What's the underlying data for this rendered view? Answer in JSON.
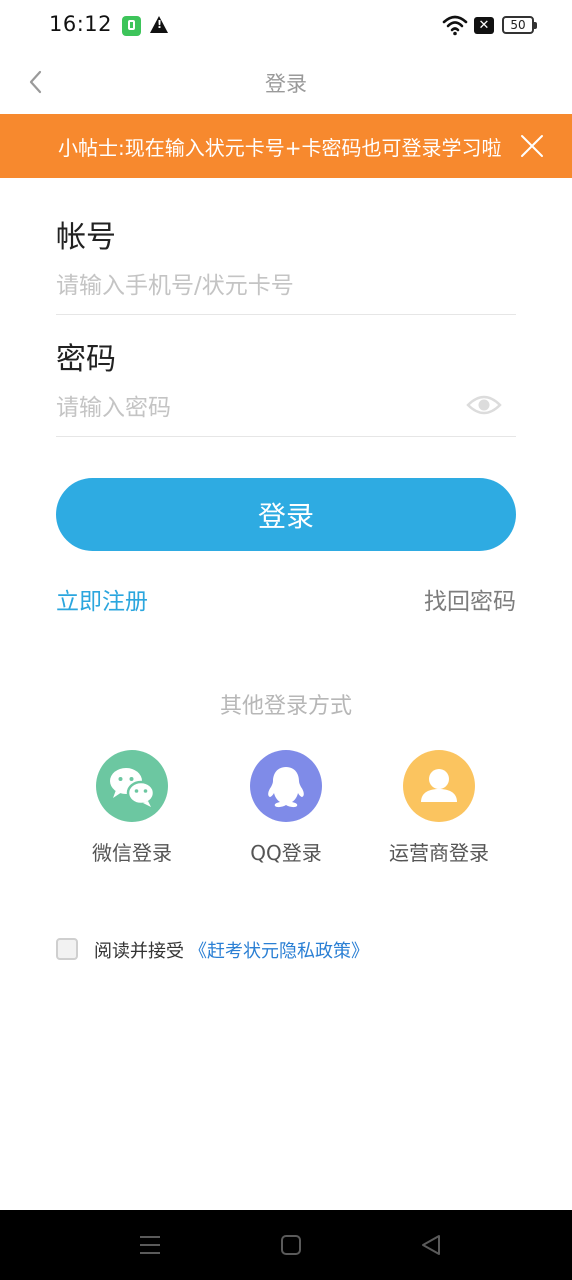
{
  "status_bar": {
    "time": "16:12",
    "battery": "50",
    "icons": [
      "app-notification-icon",
      "warning-icon",
      "wifi-icon",
      "no-sim-icon",
      "battery-icon"
    ]
  },
  "nav": {
    "title": "登录",
    "back_icon": "chevron-left-icon"
  },
  "tip": {
    "text": "小帖士:现在输入状元卡号+卡密码也可登录学习啦",
    "close_icon": "close-icon",
    "color": "#f7892e"
  },
  "form": {
    "account": {
      "label": "帐号",
      "placeholder": "请输入手机号/状元卡号",
      "value": ""
    },
    "password": {
      "label": "密码",
      "placeholder": "请输入密码",
      "value": "",
      "toggle_icon": "eye-icon"
    },
    "login_button": "登录",
    "register_link": "立即注册",
    "forgot_link": "找回密码"
  },
  "other_login": {
    "title": "其他登录方式",
    "options": [
      {
        "label": "微信登录",
        "icon": "wechat-icon",
        "color": "#6cc7a1"
      },
      {
        "label": "QQ登录",
        "icon": "qq-icon",
        "color": "#7f8be8"
      },
      {
        "label": "运营商登录",
        "icon": "user-icon",
        "color": "#fbc45f"
      }
    ]
  },
  "agreement": {
    "prefix": "阅读并接受",
    "link": "《赶考状元隐私政策》",
    "checked": false
  },
  "system_nav": {
    "icons": [
      "menu-icon",
      "home-icon",
      "back-triangle-icon"
    ]
  },
  "colors": {
    "primary": "#2eabe2",
    "link": "#2ba6de",
    "banner": "#f7892e"
  }
}
